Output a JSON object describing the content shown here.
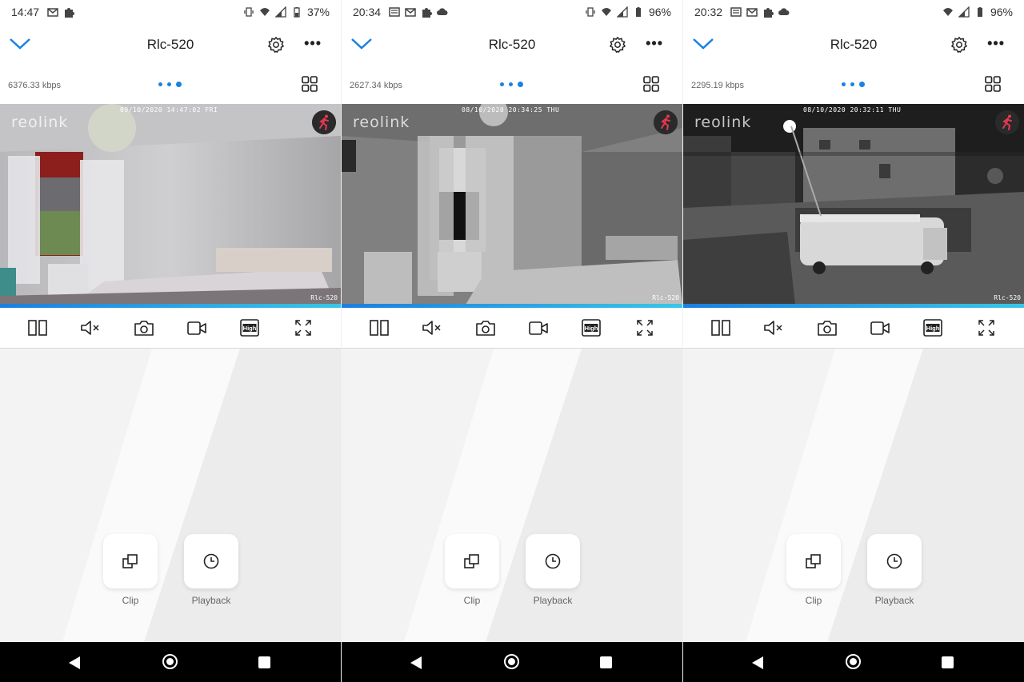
{
  "screens": [
    {
      "status": {
        "time": "14:47",
        "battery": "37%"
      },
      "header": {
        "title": "Rlc-520"
      },
      "bitrate": "6376.33 kbps",
      "video": {
        "timestamp": "09/10/2020 14:47:02 FRI",
        "brand": "reolink",
        "camera_label": "Rlc-520"
      },
      "actions": {
        "clip_label": "Clip",
        "playback_label": "Playback"
      }
    },
    {
      "status": {
        "time": "20:34",
        "battery": "96%"
      },
      "header": {
        "title": "Rlc-520"
      },
      "bitrate": "2627.34 kbps",
      "video": {
        "timestamp": "08/10/2020 20:34:25 THU",
        "brand": "reolink",
        "camera_label": "Rlc-520"
      },
      "actions": {
        "clip_label": "Clip",
        "playback_label": "Playback"
      }
    },
    {
      "status": {
        "time": "20:32",
        "battery": "96%"
      },
      "header": {
        "title": "Rlc-520"
      },
      "bitrate": "2295.19 kbps",
      "video": {
        "timestamp": "08/10/2020 20:32:11 THU",
        "brand": "reolink",
        "camera_label": "Rlc-520"
      },
      "actions": {
        "clip_label": "Clip",
        "playback_label": "Playback"
      }
    }
  ],
  "controls": {
    "quality_label": "High"
  },
  "colors": {
    "accent": "#1a82e0",
    "motion": "#e53950",
    "nav_bar": "#000000"
  }
}
